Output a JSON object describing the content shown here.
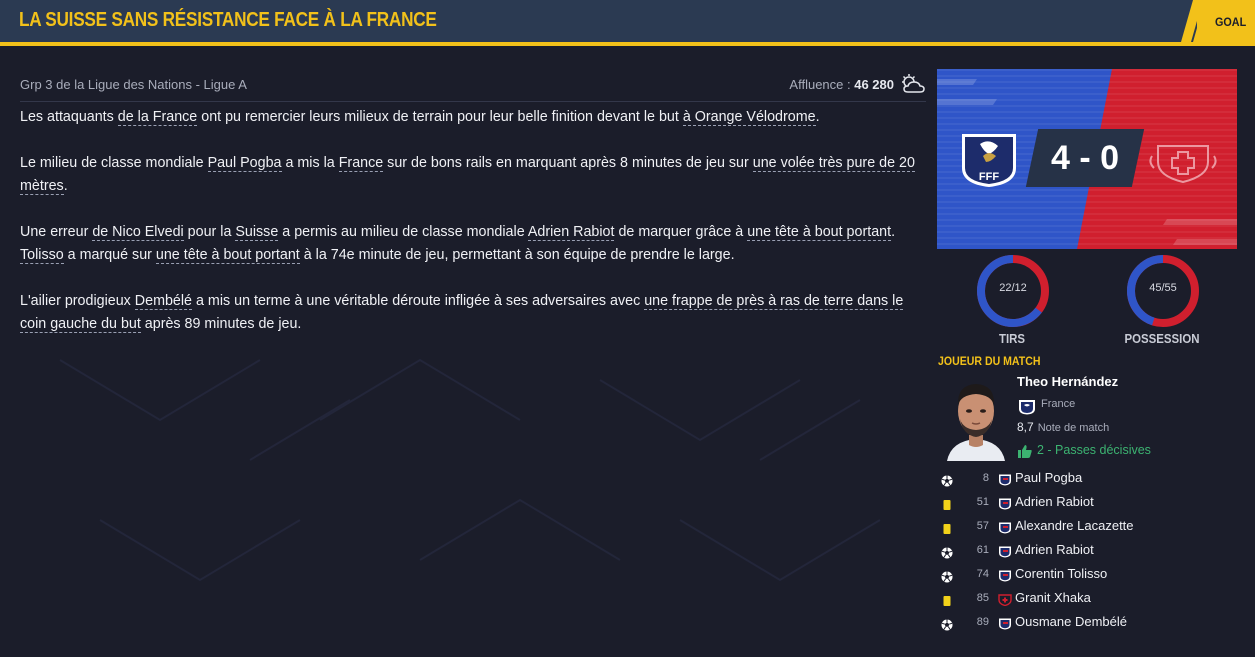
{
  "header": {
    "title": "LA SUISSE SANS RÉSISTANCE FACE À LA FRANCE",
    "tab_label": "GOAL"
  },
  "meta": {
    "competition": "Grp 3 de la Ligue des Nations - Ligue A",
    "attendance_label": "Affluence : ",
    "attendance_value": "46 280"
  },
  "article": {
    "p1": {
      "a": "Les attaquants ",
      "b": "de la France",
      "c": " ont pu remercier leurs milieux de terrain pour leur belle finition devant le but ",
      "d": "à Orange Vélodrome",
      "e": "."
    },
    "p2": {
      "a": "Le milieu de classe mondiale ",
      "b": "Paul Pogba",
      "c": " a mis la ",
      "d": "France",
      "e": " sur de bons rails en marquant après 8 minutes de jeu sur ",
      "f": "une volée très pure de 20 mètres",
      "g": "."
    },
    "p3": {
      "a": "Une erreur ",
      "b": "de Nico Elvedi",
      "c": " pour la ",
      "d": "Suisse",
      "e": " a permis au milieu de classe mondiale ",
      "f": "Adrien Rabiot",
      "g": " de marquer grâce à ",
      "h": "une tête à bout portant",
      "i": ". ",
      "j": "Tolisso",
      "k": " a marqué sur ",
      "l": "une tête à bout portant",
      "m": " à la 74e minute de jeu, permettant à son équipe de prendre le large."
    },
    "p4": {
      "a": "L'ailier prodigieux ",
      "b": "Dembélé",
      "c": " a mis un terme à une véritable déroute infligée à ses adversaires avec ",
      "d": "une frappe de près à ras de terre dans le coin gauche du but",
      "e": " après 89 minutes de jeu."
    }
  },
  "scoreboard": {
    "score": "4 - 0",
    "home_crest_text": "FFF",
    "home_color": "#2f55c8",
    "away_color": "#d01f2e"
  },
  "stats": [
    {
      "value": "22/12",
      "label": "TIRS",
      "home_fraction": 0.647
    },
    {
      "value": "45/55",
      "label": "POSSESSION",
      "home_fraction": 0.45
    }
  ],
  "motm": {
    "title": "JOUEUR DU MATCH",
    "name": "Theo Hernández",
    "nation": "France",
    "rating": "8,7",
    "rating_label": "Note de match",
    "assists": "2 - Passes décisives"
  },
  "events": [
    {
      "type": "goal",
      "minute": "8",
      "team": "fra",
      "player": "Paul Pogba"
    },
    {
      "type": "yellow",
      "minute": "51",
      "team": "fra",
      "player": "Adrien Rabiot"
    },
    {
      "type": "yellow",
      "minute": "57",
      "team": "fra",
      "player": "Alexandre Lacazette"
    },
    {
      "type": "goal",
      "minute": "61",
      "team": "fra",
      "player": "Adrien Rabiot"
    },
    {
      "type": "goal",
      "minute": "74",
      "team": "fra",
      "player": "Corentin Tolisso"
    },
    {
      "type": "yellow",
      "minute": "85",
      "team": "sui",
      "player": "Granit Xhaka"
    },
    {
      "type": "goal",
      "minute": "89",
      "team": "fra",
      "player": "Ousmane Dembélé"
    }
  ],
  "colors": {
    "accent": "#f2c11a",
    "background": "#1b1d2a",
    "header": "#2b3a52",
    "assist_green": "#3cb371"
  }
}
